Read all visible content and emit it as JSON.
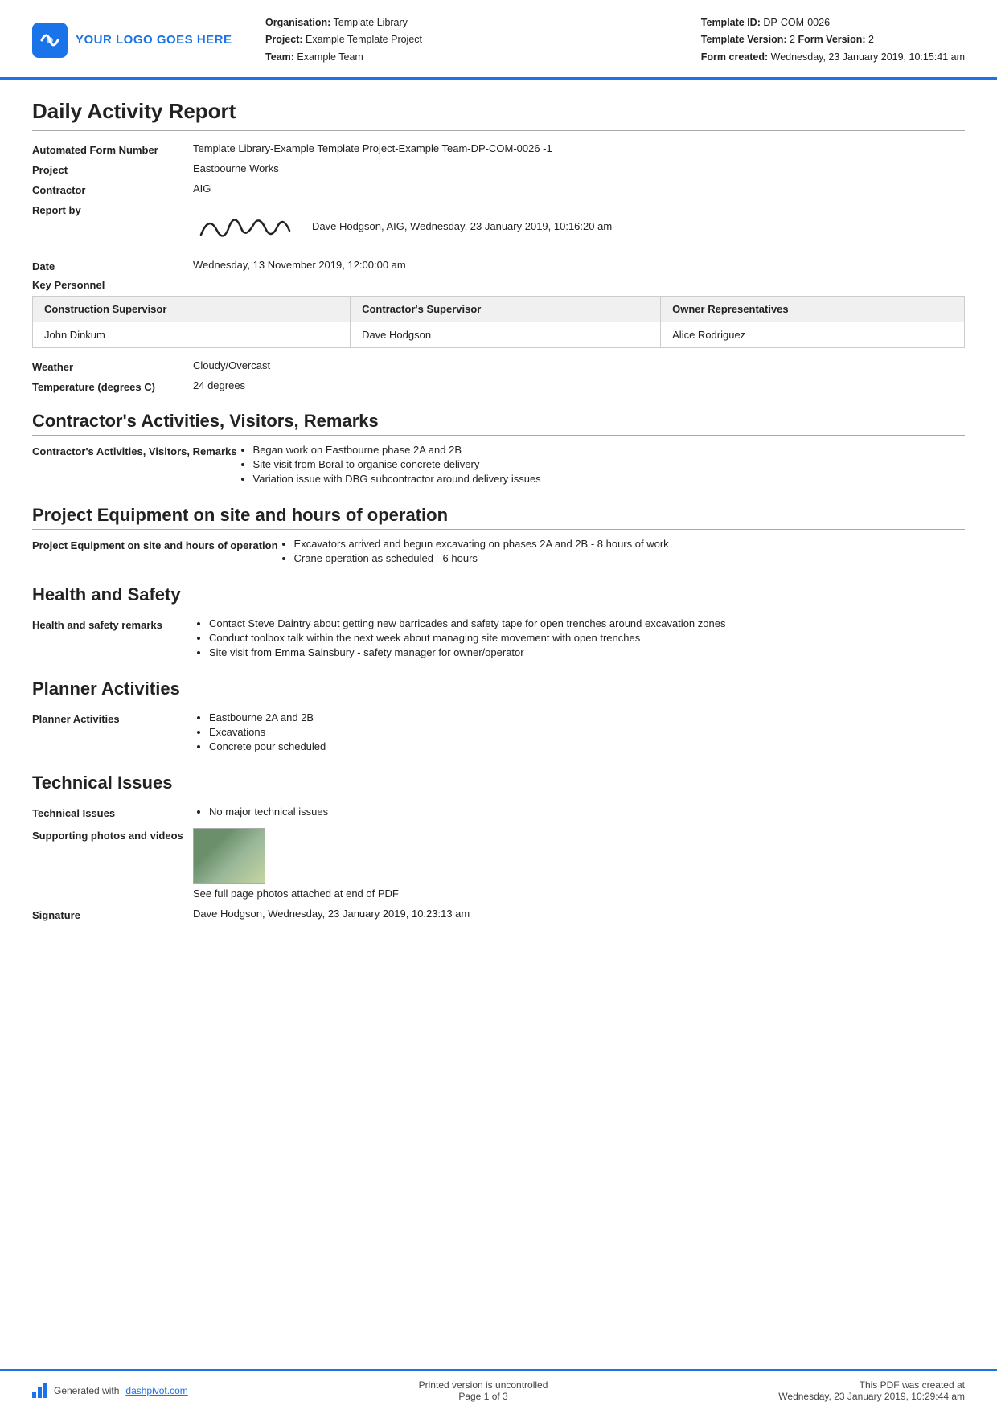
{
  "header": {
    "logo_text": "YOUR LOGO GOES HERE",
    "org_label": "Organisation:",
    "org_value": "Template Library",
    "project_label": "Project:",
    "project_value": "Example Template Project",
    "team_label": "Team:",
    "team_value": "Example Team",
    "template_id_label": "Template ID:",
    "template_id_value": "DP-COM-0026",
    "template_version_label": "Template Version:",
    "template_version_value": "2",
    "form_version_label": "Form Version:",
    "form_version_value": "2",
    "form_created_label": "Form created:",
    "form_created_value": "Wednesday, 23 January 2019, 10:15:41 am"
  },
  "report": {
    "title": "Daily Activity Report",
    "automated_label": "Automated Form Number",
    "automated_value": "Template Library-Example Template Project-Example Team-DP-COM-0026   -1",
    "project_label": "Project",
    "project_value": "Eastbourne Works",
    "contractor_label": "Contractor",
    "contractor_value": "AIG",
    "report_by_label": "Report by",
    "report_by_text": "Dave Hodgson, AIG, Wednesday, 23 January 2019, 10:16:20 am",
    "date_label": "Date",
    "date_value": "Wednesday, 13 November 2019, 12:00:00 am",
    "key_personnel_label": "Key Personnel",
    "personnel_table": {
      "headers": [
        "Construction Supervisor",
        "Contractor's Supervisor",
        "Owner Representatives"
      ],
      "rows": [
        [
          "John Dinkum",
          "Dave Hodgson",
          "Alice Rodriguez"
        ]
      ]
    },
    "weather_label": "Weather",
    "weather_value": "Cloudy/Overcast",
    "temperature_label": "Temperature (degrees C)",
    "temperature_value": "24 degrees"
  },
  "sections": [
    {
      "title": "Contractor's Activities, Visitors, Remarks",
      "field_label": "Contractor's Activities, Visitors, Remarks",
      "bullets": [
        "Began work on Eastbourne phase 2A and 2B",
        "Site visit from Boral to organise concrete delivery",
        "Variation issue with DBG subcontractor around delivery issues"
      ]
    },
    {
      "title": "Project Equipment on site and hours of operation",
      "field_label": "Project Equipment on site and hours of operation",
      "bullets": [
        "Excavators arrived and begun excavating on phases 2A and 2B - 8 hours of work",
        "Crane operation as scheduled - 6 hours"
      ]
    },
    {
      "title": "Health and Safety",
      "field_label": "Health and safety remarks",
      "bullets": [
        "Contact Steve Daintry about getting new barricades and safety tape for open trenches around excavation zones",
        "Conduct toolbox talk within the next week about managing site movement with open trenches",
        "Site visit from Emma Sainsbury - safety manager for owner/operator"
      ]
    },
    {
      "title": "Planner Activities",
      "field_label": "Planner Activities",
      "bullets": [
        "Eastbourne 2A and 2B",
        "Excavations",
        "Concrete pour scheduled"
      ]
    },
    {
      "title": "Technical Issues",
      "field_label": "Technical Issues",
      "bullets": [
        "No major technical issues"
      ]
    }
  ],
  "supporting_photos_label": "Supporting photos and videos",
  "supporting_photos_caption": "See full page photos attached at end of PDF",
  "signature_label": "Signature",
  "signature_value": "Dave Hodgson, Wednesday, 23 January 2019, 10:23:13 am",
  "footer": {
    "generated_prefix": "Generated with ",
    "dashpivot_link": "dashpivot.com",
    "center_line1": "Printed version is uncontrolled",
    "center_line2": "Page 1 of 3",
    "right_line1": "This PDF was created at",
    "right_line2": "Wednesday, 23 January 2019, 10:29:44 am"
  }
}
